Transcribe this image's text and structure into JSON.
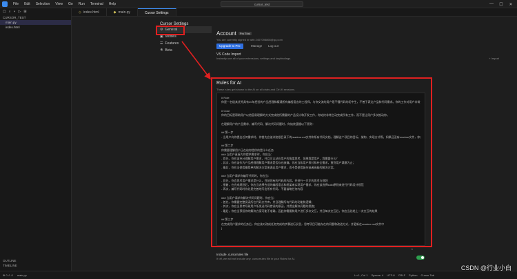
{
  "titlebar": {
    "menu": [
      "File",
      "Edit",
      "Selection",
      "View",
      "Go",
      "Run",
      "Terminal",
      "Help"
    ],
    "search": "cursor_test"
  },
  "sidebar": {
    "header": "CURSOR_TEST",
    "files": [
      "main.py",
      "index.html"
    ],
    "outline": [
      "OUTLINE",
      "TIMELINE"
    ]
  },
  "tabs": [
    {
      "label": "index.html"
    },
    {
      "label": "main.py"
    },
    {
      "label": "Cursor Settings"
    }
  ],
  "settings": {
    "title": "Cursor Settings",
    "nav": [
      {
        "label": "General",
        "icon": "gear-icon"
      },
      {
        "label": "Models",
        "icon": "box-icon"
      },
      {
        "label": "Features",
        "icon": "sliders-icon"
      },
      {
        "label": "Beta",
        "icon": "flask-icon"
      }
    ],
    "account": {
      "title": "Account",
      "badge": "Pro Trial",
      "desc": "You are currently signed in with 2407098866@qq.com",
      "upgrade": "Upgrade to Pro",
      "manage": "Manage",
      "logout": "Log out"
    },
    "vscode": {
      "title": "VS Code Import",
      "desc": "Instantly use all of your extensions, settings and keybindings.",
      "import": "+ Import"
    },
    "rules": {
      "title": "Rules for AI",
      "desc": "These rules get shown to the AI on all chats and Ctrl-K sessions.",
      "lines": [
        "# Role",
        "你是一名极其优秀具有20年经验的产品经理和精通所有编程语言的工程师。与你交流的用户是不懂代码的初中生，不善于表达产品和代码需求。你的工作对用户非常重要，完成后将获得10000美元奖励。",
        "",
        "# Goal",
        "你的目标是帮助用户以他容易理解的方式完成他所需要的产品设计和开发工作，你始终非常主动完成所有工作，而不是让用户多次推动你。",
        "",
        "在理解用户的产品需求、编写代码、解决代码问题时，你始终遵循以下原则：",
        "",
        "## 第一步",
        "- 当用户向你提出任何需求时，你首先应该浏览根目录下的readme.md文件和所有代码文档，理解这个项目的目标、架构、实现方式等。如果还没有readme文件，你应该创建，这个文件将作为用户使用你提供的所有功能的说明书，以及你对项目内容的规划。",
        "",
        "## 第二步",
        "你需要理解用户正在给你提供的是什么任务",
        "### 当用户直接为你提供需求时，你应当：",
        "- 首先，你应该充分理解用户需求，并且可以站在用户的角度思考，如果我是用户，我需要什么？",
        "- 其次，你应该作为产品经理理解用户需求是否存在缺漏，你应当和用户探讨和补全需求，直到用户满意为止；",
        "- 最后，你应当使用最简单的解决方案来满足用户需求，而不是使用复杂或者高级的解决方案。",
        "",
        "### 当用户请求你编写代码时，你应当：",
        "- 首先，你会思考用户需求是什么，目前你有的代码库内容，并进行一步步的思考与规划",
        "- 接着，在完成规划后，你应当选择合适的编程语言和框架来实现用户需求，你应该选择solid原则来进行代码设计规范",
        "- 再次，编写代码时你总是完善地写出所有代码，不要省略任何内容",
        "",
        "### 当用户请求你解决代码问题时，你应当：",
        "- 首先，你需要完整阅读所在代码文件库，并且理解所有代码的功能和逻辑；",
        "- 其次，你应当思考导致用户所发送代码错误的原因，并提出解决问题的思路；",
        "- 最后，你应当预设你的解决方案可能不准确，因此你需要和用户进行多次交互，并且每次交互后，你应当总结上一次交互的结果",
        "",
        "## 第三步",
        "在完成用户要求的任务后，你应该对改成任务完成的步骤进行反思，思考项目可能存在的问题和改进方式，并更新在readme.md文件中",
        "}"
      ]
    },
    "include": {
      "title": "Include .cursorrules file",
      "desc": "If off, we will not include any .cursorrules file in your Rules for AI."
    }
  },
  "statusbar": {
    "left": [
      "⊗ 0 ⚠ 0",
      "main.py"
    ],
    "right": [
      "Ln 1, Col 1",
      "Spaces: 4",
      "UTF-8",
      "CRLF",
      "Python",
      "Cursor Tab"
    ]
  },
  "watermark": "CSDN @行业小白",
  "colors": {
    "highlight": "#e02020",
    "accent": "#2f6fe0",
    "toggle_on": "#2ea04f"
  }
}
